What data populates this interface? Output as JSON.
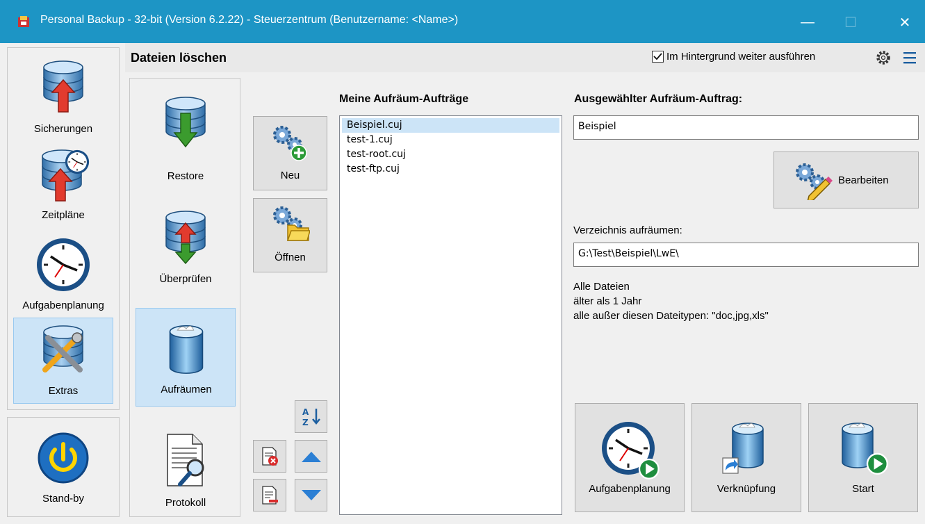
{
  "window": {
    "title": "Personal Backup - 32-bit (Version 6.2.22) - Steuerzentrum (Benutzername: <Name>)",
    "minimize": "—",
    "maximize": "☐",
    "close": "✕"
  },
  "sidebar": {
    "items": [
      {
        "label": "Sicherungen"
      },
      {
        "label": "Zeitpläne"
      },
      {
        "label": "Aufgabenplanung"
      },
      {
        "label": "Extras"
      }
    ],
    "standby": "Stand-by"
  },
  "header": {
    "title": "Dateien löschen",
    "background_label": "Im Hintergrund weiter ausführen",
    "background_checked": true
  },
  "subnav": {
    "items": [
      {
        "label": "Restore"
      },
      {
        "label": "Überprüfen"
      },
      {
        "label": "Aufräumen"
      },
      {
        "label": "Protokoll"
      }
    ]
  },
  "actions": {
    "new_label": "Neu",
    "open_label": "Öffnen"
  },
  "jobs": {
    "heading": "Meine Aufräum-Aufträge",
    "items": [
      "Beispiel.cuj",
      "test-1.cuj",
      "test-root.cuj",
      "test-ftp.cuj"
    ]
  },
  "selected_job": {
    "heading": "Ausgewählter Aufräum-Auftrag:",
    "name": "Beispiel",
    "edit_label": "Bearbeiten",
    "dir_label": "Verzeichnis aufräumen:",
    "dir_value": "G:\\Test\\Beispiel\\LwE\\",
    "info": [
      "Alle Dateien",
      "älter als 1 Jahr",
      "alle außer diesen Dateitypen: \"doc,jpg,xls\""
    ]
  },
  "bottom": {
    "schedule_label": "Aufgabenplanung",
    "shortcut_label": "Verknüpfung",
    "start_label": "Start"
  },
  "colors": {
    "titlebar": "#1d95c5",
    "selected_bg": "#cce4f7",
    "selected_border": "#99c9ef"
  }
}
